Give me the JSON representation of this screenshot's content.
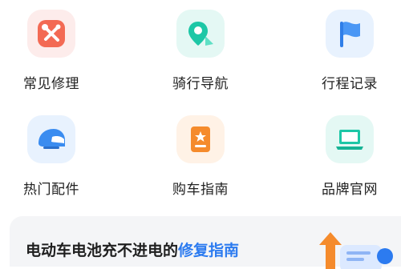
{
  "grid": {
    "items": [
      {
        "label": "常见修理",
        "icon": "wrench-screwdriver-icon",
        "color": "#f25c4a"
      },
      {
        "label": "骑行导航",
        "icon": "map-pin-icon",
        "color": "#1dc7a6"
      },
      {
        "label": "行程记录",
        "icon": "flag-icon",
        "color": "#3a8cf0"
      },
      {
        "label": "热门配件",
        "icon": "helmet-icon",
        "color": "#3a8cf0"
      },
      {
        "label": "购车指南",
        "icon": "guide-book-icon",
        "color": "#f58b2c"
      },
      {
        "label": "品牌官网",
        "icon": "laptop-icon",
        "color": "#1dc7a6"
      }
    ]
  },
  "banner": {
    "text": "电动车电池充不进电的",
    "highlight": "修复指南",
    "highlight_color": "#2c7bf0",
    "icon": "arrow-document-illustration"
  }
}
